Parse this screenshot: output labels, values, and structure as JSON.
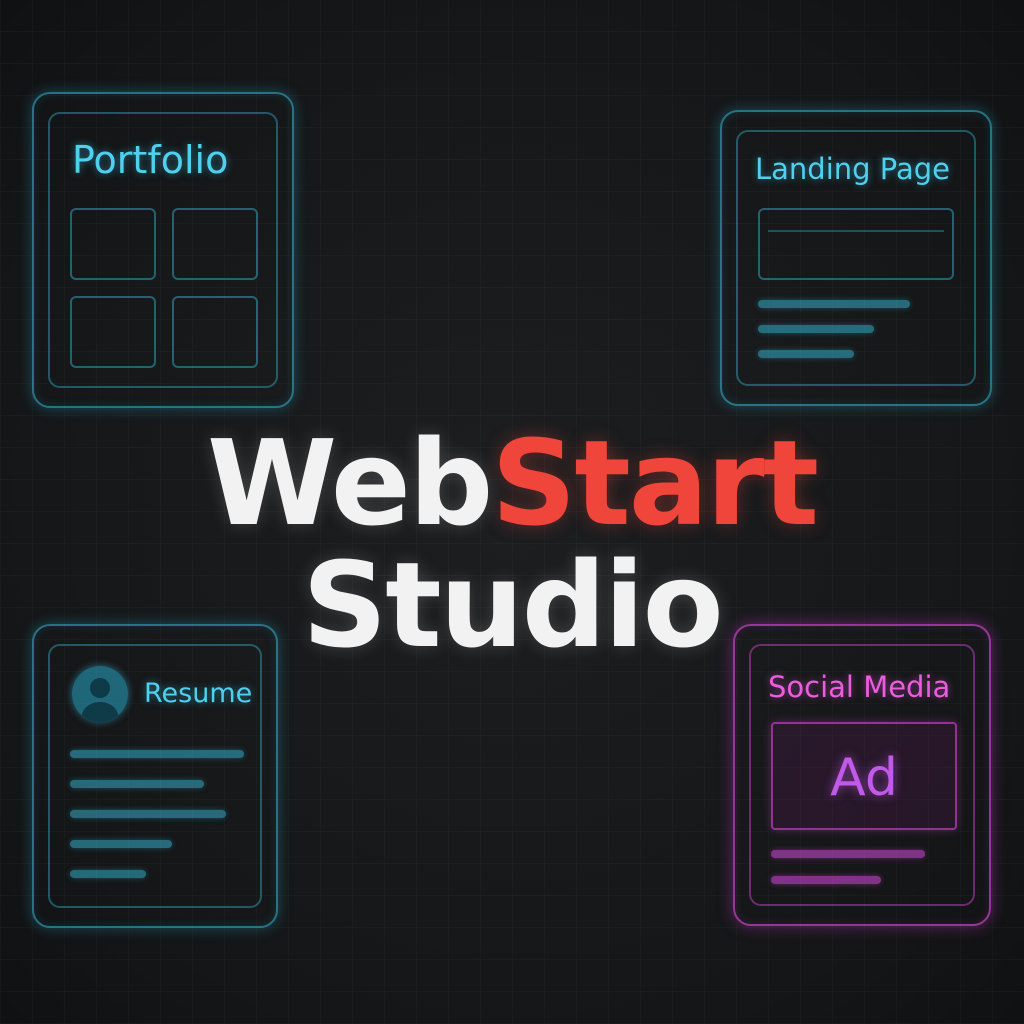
{
  "brand": {
    "word1": "Web",
    "word2": "Start",
    "word3": "Studio",
    "accent_color": "#f0453a",
    "text_color": "#f2f2f2"
  },
  "cards": {
    "portfolio": {
      "label": "Portfolio",
      "color": "#4fd0ee"
    },
    "landing": {
      "label": "Landing Page",
      "color": "#4fd0ee"
    },
    "resume": {
      "label": "Resume",
      "avatar_icon": "user-avatar-icon",
      "color": "#4fd0ee"
    },
    "social": {
      "label": "Social Media",
      "ad_label": "Ad",
      "color": "#ea5ddc"
    }
  }
}
